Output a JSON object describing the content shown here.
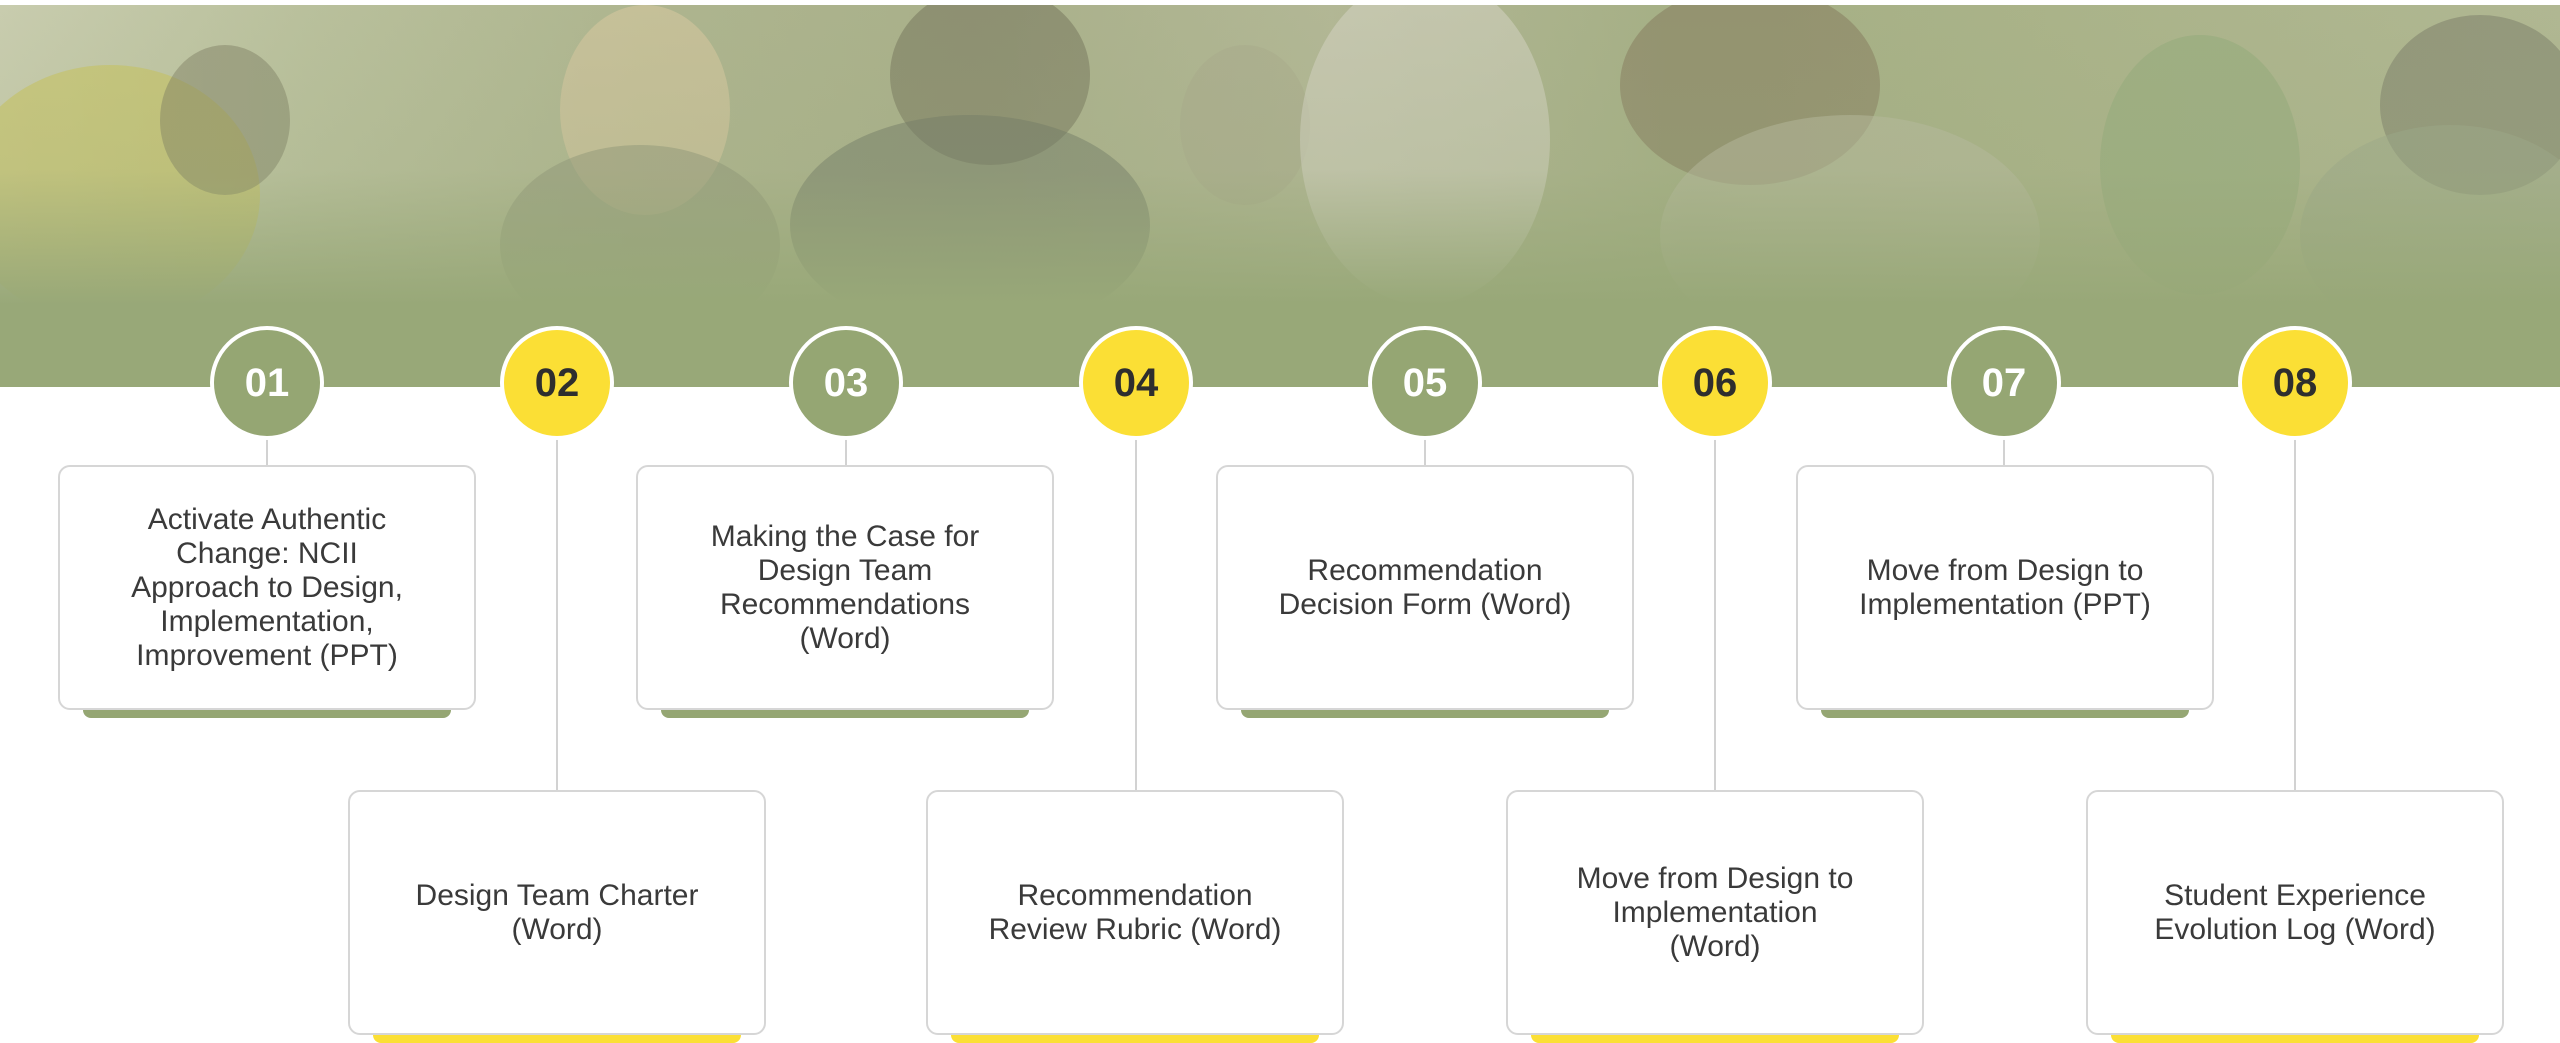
{
  "colors": {
    "green": "#95a673",
    "yellow": "#fbdf35",
    "banner": "#98a878",
    "card_border": "#d6d6d6"
  },
  "steps": [
    {
      "number": "01",
      "color": "green",
      "label": "Activate Authentic\nChange: NCII\nApproach to Design,\nImplementation,\nImprovement (PPT)"
    },
    {
      "number": "02",
      "color": "yellow",
      "label": "Design Team Charter\n(Word)"
    },
    {
      "number": "03",
      "color": "green",
      "label": "Making the Case for\nDesign Team\nRecommendations\n(Word)"
    },
    {
      "number": "04",
      "color": "yellow",
      "label": "Recommendation\nReview Rubric (Word)"
    },
    {
      "number": "05",
      "color": "green",
      "label": "Recommendation\nDecision Form (Word)"
    },
    {
      "number": "06",
      "color": "yellow",
      "label": "Move from Design to\nImplementation\n(Word)"
    },
    {
      "number": "07",
      "color": "green",
      "label": "Move from Design to\nImplementation (PPT)"
    },
    {
      "number": "08",
      "color": "yellow",
      "label": "Student Experience\nEvolution Log (Word)"
    }
  ]
}
